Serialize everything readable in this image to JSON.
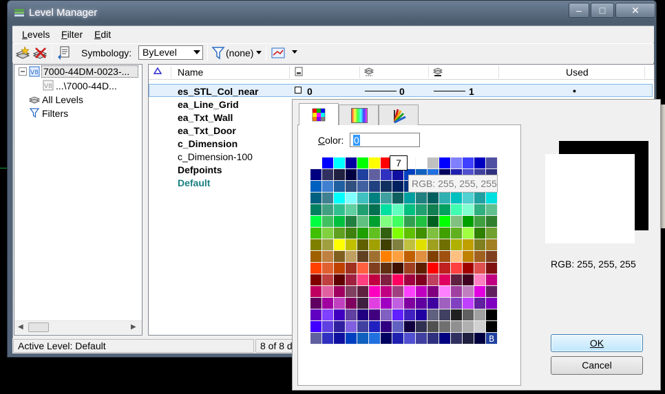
{
  "window": {
    "title": "Level Manager"
  },
  "menu": [
    {
      "label": "Levels",
      "ul": "L",
      "rest": "evels"
    },
    {
      "label": "Filter",
      "ul": "F",
      "rest": "ilter"
    },
    {
      "label": "Edit",
      "ul": "E",
      "rest": "dit"
    }
  ],
  "toolbar": {
    "symbology_label": "Symbology:",
    "symbology_value": "ByLevel",
    "filter_value": "(none)"
  },
  "tree": {
    "root": "7000-44DM-0023-...",
    "child": "...\\7000-44D...",
    "all_levels": "All Levels",
    "filters": "Filters"
  },
  "table": {
    "headers": {
      "name": "Name",
      "used": "Used"
    },
    "rows": [
      {
        "name": "es_STL_Col_near",
        "bold": true,
        "color_text": "#000000",
        "color": "0",
        "style": "0",
        "weight": "1",
        "used": "•"
      },
      {
        "name": "ea_Line_Grid",
        "bold": true,
        "color_text": "#000000"
      },
      {
        "name": "ea_Txt_Wall",
        "bold": true,
        "color_text": "#000000"
      },
      {
        "name": "ea_Txt_Door",
        "bold": true,
        "color_text": "#000000"
      },
      {
        "name": "c_Dimension",
        "bold": true,
        "color_text": "#000000"
      },
      {
        "name": "c_Dimension-100",
        "bold": false,
        "color_text": "#000000"
      },
      {
        "name": "Defpoints",
        "bold": true,
        "color_text": "#000000"
      },
      {
        "name": "Default",
        "bold": true,
        "color_text": "#1a7f80"
      }
    ]
  },
  "status": {
    "active_level": "Active Level: Default",
    "count": "8 of 8 d"
  },
  "dialog": {
    "color_label": "Color:",
    "color_value": "0",
    "hover_index": "7",
    "hover_rgb": "RGB: 255, 255, 255",
    "selected_rgb": "RGB: 255, 255, 255",
    "ok": "OK",
    "cancel": "Cancel",
    "palette_marker": "B",
    "palette_rows": [
      [
        "#ffffff",
        "#0000ff",
        "#00ffff",
        "#0000a0",
        "#00ff00",
        "#ffff00",
        "#ff0000",
        "#ff00ff",
        "#ffffff",
        "#ffffff",
        "#c0c0c0",
        "#0000ff",
        "#8080ff",
        "#4040ff",
        "#0000c0",
        "#5050a0"
      ],
      [
        "#000080",
        "#303060",
        "#202040",
        "#000040",
        "#2040a0",
        "#6060a0",
        "#3030c0",
        "#1010a0",
        "#0040c0",
        "#1060c0",
        "#2070e0",
        "#000060",
        "#2020b0",
        "#5050d0",
        "#4040a0",
        "#303080"
      ],
      [
        "#0060c0",
        "#4080d0",
        "#2060a0",
        "#305080",
        "#4060a0",
        "#204080",
        "#103060",
        "#002060",
        "#003080",
        "#1050a0",
        "#2060c0",
        "#3050c0",
        "#1040b0",
        "#2050a0",
        "#103080",
        "#2040c0"
      ],
      [
        "#006080",
        "#408090",
        "#00ffff",
        "#80ffff",
        "#40c0c0",
        "#008080",
        "#40a0a0",
        "#106060",
        "#00a0a0",
        "#208080",
        "#006060",
        "#30b0b0",
        "#00c0c0",
        "#50d0d0",
        "#20a0a0",
        "#00e0e0"
      ],
      [
        "#008060",
        "#40a080",
        "#30c090",
        "#60d0a0",
        "#20a070",
        "#007050",
        "#00e0a0",
        "#60ffc0",
        "#00c080",
        "#20a070",
        "#108050",
        "#00a060",
        "#40ffb0",
        "#80ffd0",
        "#30b080",
        "#60c090"
      ],
      [
        "#00ff40",
        "#40c060",
        "#00c040",
        "#208040",
        "#60c080",
        "#00a030",
        "#80ff80",
        "#40ff60",
        "#30a050",
        "#20c040",
        "#006020",
        "#00ff00",
        "#80c080",
        "#00a000",
        "#40a040",
        "#308030"
      ],
      [
        "#40c000",
        "#80d040",
        "#60a020",
        "#408010",
        "#20a000",
        "#60c020",
        "#306010",
        "#80ff00",
        "#60c000",
        "#409000",
        "#80c040",
        "#40a000",
        "#60b020",
        "#a0ff40",
        "#308000",
        "#70a030"
      ],
      [
        "#808000",
        "#a0a040",
        "#ffff00",
        "#c0c000",
        "#606000",
        "#a0a000",
        "#404000",
        "#808040",
        "#c0c040",
        "#e0e000",
        "#a0a020",
        "#707000",
        "#b0b000",
        "#c0a000",
        "#808020",
        "#a08020"
      ],
      [
        "#a06000",
        "#c08040",
        "#806020",
        "#c0a060",
        "#604020",
        "#a07030",
        "#ff8000",
        "#ffa040",
        "#c06000",
        "#e09040",
        "#804000",
        "#a05010",
        "#ffc080",
        "#c08000",
        "#a06020",
        "#804020"
      ],
      [
        "#ff4000",
        "#e06030",
        "#c04000",
        "#a03020",
        "#ff6040",
        "#804020",
        "#603010",
        "#401000",
        "#a04020",
        "#602000",
        "#ff0000",
        "#c02020",
        "#ff4040",
        "#a00000",
        "#e05050",
        "#801010"
      ],
      [
        "#800000",
        "#c04040",
        "#600000",
        "#a02040",
        "#ff4080",
        "#c00040",
        "#802040",
        "#ff0060",
        "#a00040",
        "#800020",
        "#c04060",
        "#e00060",
        "#602040",
        "#400020",
        "#ff80c0",
        "#c00080"
      ],
      [
        "#c00060",
        "#e060a0",
        "#a00060",
        "#804060",
        "#602040",
        "#ff00c0",
        "#c00080",
        "#a04080",
        "#ff40ff",
        "#c000c0",
        "#800080",
        "#ff80ff",
        "#a040a0",
        "#c080c0",
        "#e000e0",
        "#602060"
      ],
      [
        "#600060",
        "#a000a0",
        "#c040c0",
        "#800060",
        "#402040",
        "#e040e0",
        "#a000c0",
        "#c060e0",
        "#8000a0",
        "#6000a0",
        "#4000a0",
        "#a060c0",
        "#8040c0",
        "#c040ff",
        "#6020a0",
        "#8000c0"
      ],
      [
        "#6000c0",
        "#8040ff",
        "#4000c0",
        "#6040a0",
        "#200080",
        "#400080",
        "#8060c0",
        "#6020ff",
        "#4020c0",
        "#2000a0",
        "#606080",
        "#404060",
        "#202020",
        "#606060",
        "#a0a0a0",
        "#000000"
      ],
      [
        "#4000ff",
        "#6040e0",
        "#3020a0",
        "#8060e0",
        "#4040a0",
        "#2020c0",
        "#300080",
        "#6060c0",
        "#100040",
        "#303050",
        "#505050",
        "#707070",
        "#909090",
        "#b0b0b0",
        "#d0d0d0",
        "#000000"
      ]
    ],
    "colors": {
      "tab_border": "#a5a5a5",
      "ok_border": "#3c7fb1"
    }
  }
}
